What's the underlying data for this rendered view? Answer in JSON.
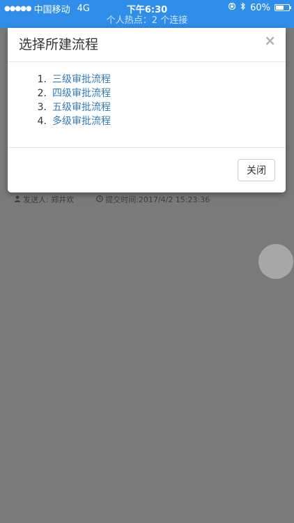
{
  "status_bar": {
    "signal_dots": "●●●●●",
    "carrier": "中国移动",
    "network": "4G",
    "time": "下午6:30",
    "battery_percent": "60%",
    "battery_level": 0.6,
    "icons": [
      "signal-icon",
      "orientation-lock-icon",
      "bluetooth-icon",
      "battery-icon"
    ]
  },
  "hotspot_bar": {
    "text": "个人热点：2 个连接"
  },
  "background": {
    "sender": "发送人: 郑井欢",
    "submit_time": "提交时间:2017/4/2 15:23:36",
    "icons": [
      "user-icon",
      "clock-icon"
    ]
  },
  "modal": {
    "title": "选择所建流程",
    "close_glyph": "×",
    "items": [
      {
        "number": "1.",
        "label": "三级审批流程"
      },
      {
        "number": "2.",
        "label": "四级审批流程"
      },
      {
        "number": "3.",
        "label": "五级审批流程"
      },
      {
        "number": "4.",
        "label": "多级审批流程"
      }
    ],
    "close_button_label": "关闭"
  },
  "colors": {
    "status_bar_bg": "#2f8ee9",
    "overlay_bg": "#7a7a7a",
    "link": "#337ab7"
  }
}
